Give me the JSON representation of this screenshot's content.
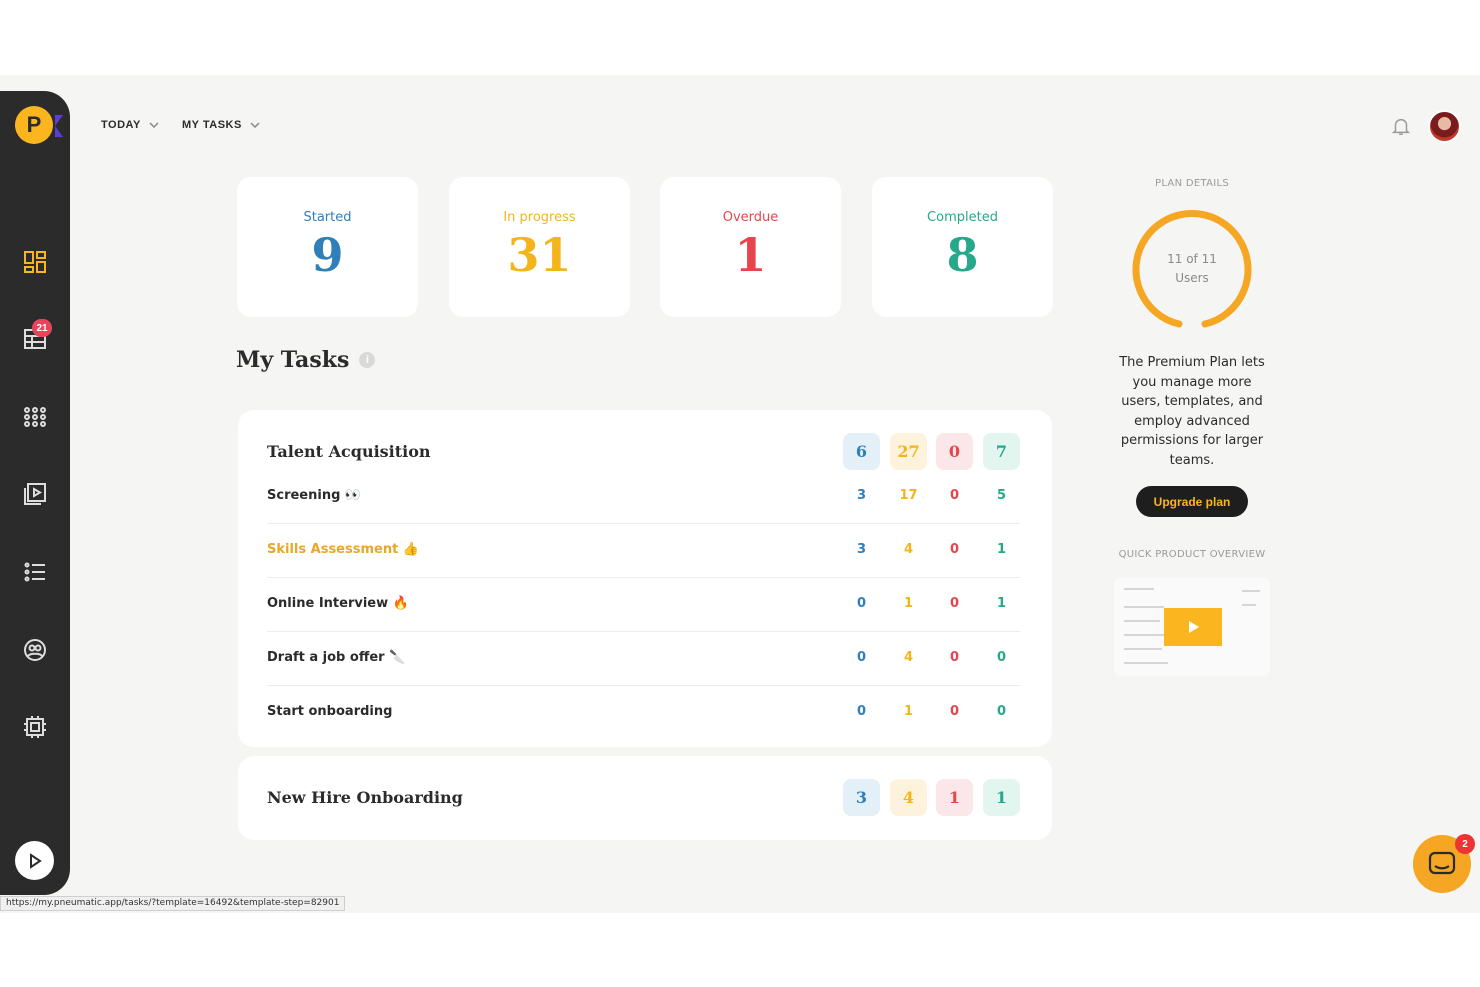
{
  "topbar": {
    "today_label": "TODAY",
    "mytasks_label": "MY TASKS"
  },
  "sidebar": {
    "badge_count": "21",
    "logo_letter": "P"
  },
  "stats": [
    {
      "label": "Started",
      "value": "9",
      "color": "#2f7fb8"
    },
    {
      "label": "In progress",
      "value": "31",
      "color": "#f3b41c"
    },
    {
      "label": "Overdue",
      "value": "1",
      "color": "#e6454c"
    },
    {
      "label": "Completed",
      "value": "8",
      "color": "#26a88a"
    }
  ],
  "my_tasks": {
    "title": "My Tasks",
    "info": "i",
    "templates": [
      {
        "title": "Talent Acquisition",
        "totals": [
          "6",
          "27",
          "0",
          "7"
        ],
        "steps": [
          {
            "name": "Screening 👀",
            "counts": [
              "3",
              "17",
              "0",
              "5"
            ]
          },
          {
            "name": "Skills Assessment 👍",
            "counts": [
              "3",
              "4",
              "0",
              "1"
            ]
          },
          {
            "name": "Online Interview 🔥",
            "counts": [
              "0",
              "1",
              "0",
              "1"
            ]
          },
          {
            "name": "Draft a job offer 🔪",
            "counts": [
              "0",
              "4",
              "0",
              "0"
            ]
          },
          {
            "name": "Start onboarding",
            "counts": [
              "0",
              "1",
              "0",
              "0"
            ]
          }
        ]
      },
      {
        "title": "New Hire Onboarding",
        "totals": [
          "3",
          "4",
          "1",
          "1"
        ]
      }
    ]
  },
  "plan": {
    "heading": "PLAN DETAILS",
    "users_line1": "11 of 11",
    "users_line2": "Users",
    "users_used": 11,
    "users_total": 11,
    "description": "The Premium Plan lets you manage more users, templates, and employ advanced permissions for larger teams.",
    "upgrade_label": "Upgrade plan",
    "overview_heading": "QUICK PRODUCT OVERVIEW"
  },
  "chat": {
    "badge": "2"
  },
  "status_url": "https://my.pneumatic.app/tasks/?template=16492&template-step=82901"
}
